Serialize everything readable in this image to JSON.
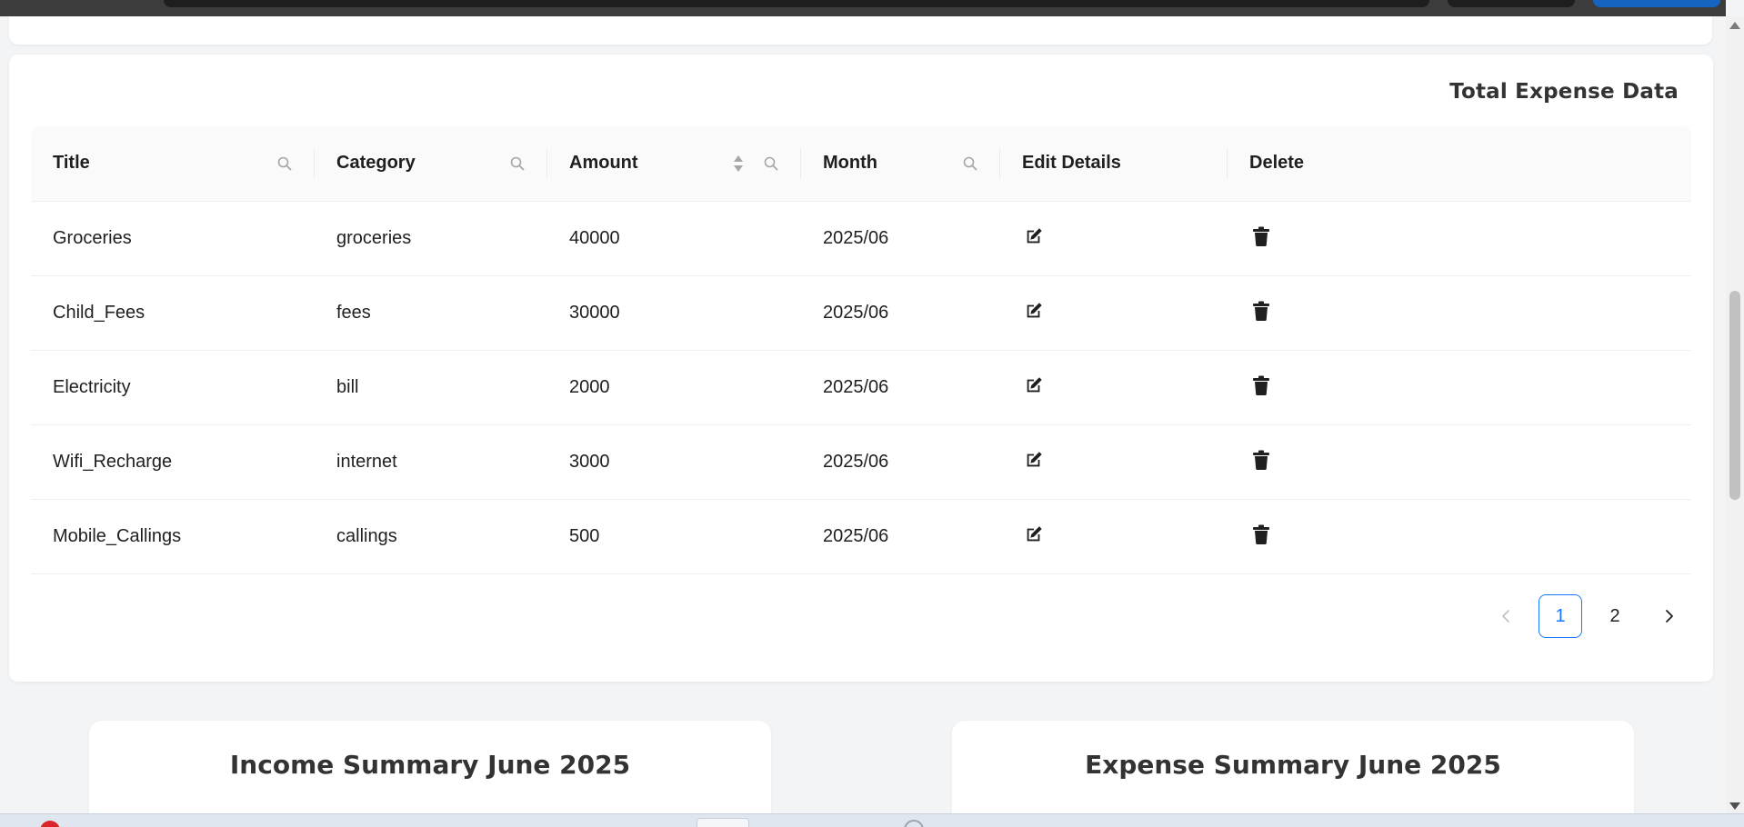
{
  "card": {
    "title": "Total Expense Data"
  },
  "table": {
    "columns": [
      "Title",
      "Category",
      "Amount",
      "Month",
      "Edit Details",
      "Delete"
    ],
    "rows": [
      [
        "Groceries",
        "groceries",
        "40000",
        "2025/06"
      ],
      [
        "Child_Fees",
        "fees",
        "30000",
        "2025/06"
      ],
      [
        "Electricity",
        "bill",
        "2000",
        "2025/06"
      ],
      [
        "Wifi_Recharge",
        "internet",
        "3000",
        "2025/06"
      ],
      [
        "Mobile_Callings",
        "callings",
        "500",
        "2025/06"
      ]
    ],
    "row_icons": {
      "edit": "edit-icon",
      "delete": "trash-icon"
    }
  },
  "pagination": {
    "prev_icon": "chevron-left-icon",
    "next_icon": "chevron-right-icon",
    "pages": [
      "1",
      "2"
    ],
    "current": "1"
  },
  "summary": {
    "income_title": "Income Summary June 2025",
    "expense_title": "Expense Summary June 2025"
  },
  "colors": {
    "accent": "#1677ff",
    "header_bg": "#fafafa",
    "page_bg": "#f3f4f6"
  }
}
